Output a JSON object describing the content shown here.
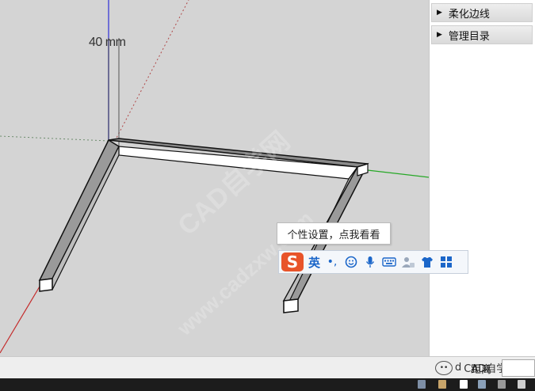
{
  "viewport": {
    "dimension_label": "40 mm",
    "watermark_main": "CAD自学网",
    "watermark_url": "www.cadzxw.com"
  },
  "tray": {
    "items": [
      {
        "label": "柔化边线"
      },
      {
        "label": "管理目录"
      }
    ]
  },
  "tooltip": {
    "text": "个性设置，点我看看"
  },
  "ime": {
    "logo": "S",
    "lang": "英",
    "punct": "•,",
    "icons": [
      "smiley-icon",
      "microphone-icon",
      "keyboard-icon",
      "user-icon",
      "shirt-icon",
      "grid-icon"
    ]
  },
  "statusbar": {
    "measure_label": "距离",
    "measure_value": "",
    "wechat_text": "CAD自学网",
    "wechat_prefix": "d"
  },
  "colors": {
    "viewport_bg": "#d4d4d4",
    "axis_blue": "#3b3bd6",
    "axis_green": "#26a826",
    "axis_red": "#c42a2a",
    "ime_accent": "#1b66c9",
    "ime_logo": "#e8542a"
  }
}
